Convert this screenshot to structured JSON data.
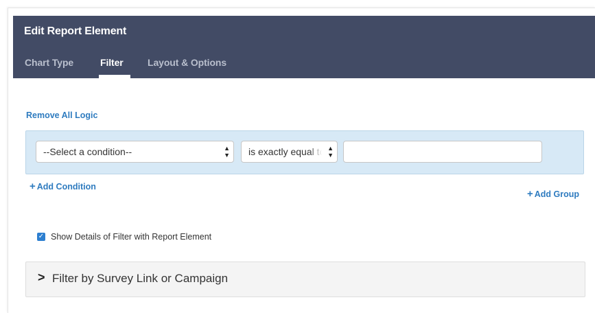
{
  "header": {
    "title": "Edit Report Element",
    "tabs": [
      {
        "label": "Chart Type",
        "active": false
      },
      {
        "label": "Filter",
        "active": true
      },
      {
        "label": "Layout & Options",
        "active": false
      }
    ]
  },
  "filter": {
    "remove_all_label": "Remove All Logic",
    "condition_select": {
      "selected": "--Select a condition--"
    },
    "operator_select": {
      "selected": "is exactly equal to"
    },
    "value_input": {
      "value": "",
      "placeholder": ""
    },
    "add_condition_label": "Add Condition",
    "add_group_label": "Add Group",
    "show_details": {
      "label": "Show Details of Filter with Report Element",
      "checked": true
    },
    "accordion_label": "Filter by Survey Link or Campaign"
  },
  "colors": {
    "header_bg": "#424b65",
    "link": "#2e7bbf",
    "condition_box_bg": "#d7e9f6",
    "checkbox": "#2d7fd0"
  },
  "icons": [
    "chevron-right-icon",
    "plus-icon",
    "select-arrows-icon",
    "checkmark-icon"
  ]
}
